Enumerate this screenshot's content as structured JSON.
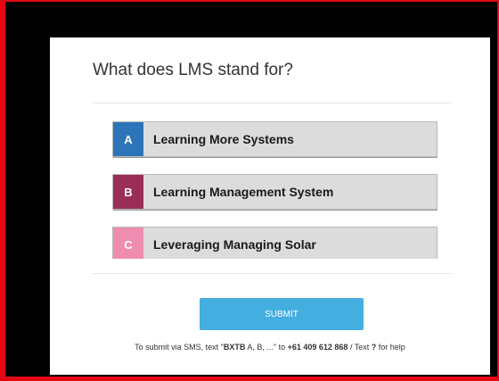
{
  "quiz": {
    "question": "What does LMS stand for?",
    "options": [
      {
        "letter": "A",
        "label": "Learning More Systems",
        "color": "#2d74b8"
      },
      {
        "letter": "B",
        "label": "Learning Management System",
        "color": "#9a2e57"
      },
      {
        "letter": "C",
        "label": "Leveraging Managing Solar",
        "color": "#ee8db0"
      }
    ],
    "submit_label": "SUBMIT"
  },
  "sms": {
    "prefix": "To submit via SMS, text \"",
    "code": "BXTB",
    "middle": " A, B, ...\" to ",
    "number": "+61 409 612 868",
    "help_prefix": " / Text ",
    "help_key": "?",
    "help_suffix": " for help"
  },
  "colors": {
    "frame_border": "#e30613",
    "submit_bg": "#44aee0"
  }
}
